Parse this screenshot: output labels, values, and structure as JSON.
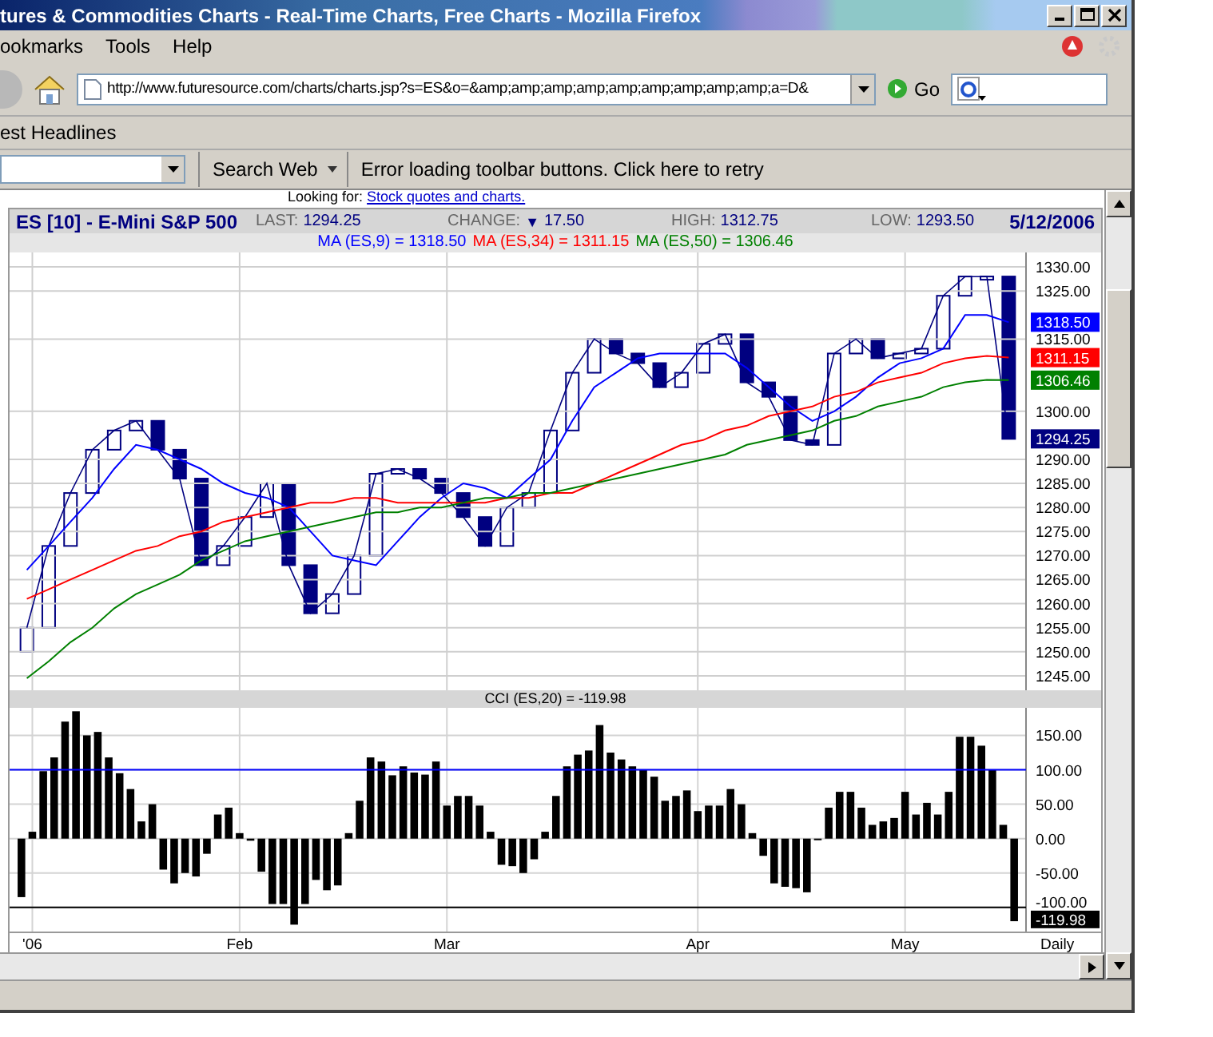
{
  "window": {
    "title": "tures & Commodities Charts - Real-Time Charts, Free Charts - Mozilla Firefox"
  },
  "menu": [
    "ookmarks",
    "Tools",
    "Help"
  ],
  "navigation": {
    "url": "http://www.futuresource.com/charts/charts.jsp?s=ES&o=&amp;amp;amp;amp;amp;amp;amp;amp;amp;a=D&",
    "go": "Go"
  },
  "bookmarks": [
    "est Headlines"
  ],
  "toolbar": {
    "search_button": "Search Web",
    "error_link": "Error loading toolbar buttons. Click here to retry"
  },
  "page": {
    "looking_for": "Looking for:",
    "looking_link": "Stock quotes and charts."
  },
  "chart_header": {
    "date": "5/12/2006",
    "fields": [
      {
        "label": "LAST:",
        "value": "1294.25"
      },
      {
        "label": "CHANGE:",
        "arrow": "▼",
        "value": "17.50"
      },
      {
        "label": "HIGH:",
        "value": "1312.75"
      },
      {
        "label": "LOW:",
        "value": "1293.50"
      }
    ]
  },
  "ma_legend": [
    {
      "value": "= 1318.50"
    },
    {
      "value": "= 1311.15"
    },
    {
      "value": "= 1306.46"
    }
  ],
  "price_panel": {
    "last_values": [
      {
        "text": "1318.50",
        "color": "#0000ff"
      },
      {
        "text": "1311.15",
        "color": "#ff0000"
      },
      {
        "text": "1306.46",
        "color": "#008000"
      },
      {
        "text": "1294.25",
        "color": "#000080"
      }
    ],
    "chart_data": {
      "type": "line",
      "grid": true,
      "categories": [
        null,
        null,
        null,
        null,
        null,
        null,
        null,
        null,
        null,
        null,
        null,
        null,
        null,
        null,
        null,
        null,
        null,
        null,
        null,
        null,
        null,
        null,
        null,
        null,
        null,
        null,
        null,
        null,
        null,
        null,
        null,
        null,
        null,
        null,
        null,
        null,
        null,
        null,
        null,
        null,
        null,
        null,
        null,
        null,
        null,
        null
      ],
      "series": [
        {
          "name": "ES [10] - E-Mini S&P 500",
          "color": "#000080",
          "values": [
            1255,
            1272,
            1283,
            1292,
            1296,
            1298,
            1292,
            1286,
            1268,
            1272,
            1278,
            1285,
            1268,
            1258,
            1262,
            1270,
            1287,
            1288,
            1286,
            1283,
            1278,
            1272,
            1280,
            1283,
            1296,
            1308,
            1315,
            1312,
            1310,
            1305,
            1308,
            1314,
            1316,
            1306,
            1303,
            1294,
            1293,
            1312,
            1315,
            1311,
            1312,
            1313,
            1324,
            1328,
            1328,
            1294.25
          ]
        },
        {
          "name": "MA (ES,9)",
          "color": "#0000ff",
          "values": [
            1267,
            1272,
            1277,
            1282,
            1288,
            1293,
            1292,
            1290,
            1288,
            1285,
            1283,
            1282,
            1280,
            1275,
            1270,
            1269,
            1268,
            1273,
            1278,
            1282,
            1285,
            1284,
            1282,
            1286,
            1290,
            1298,
            1305,
            1308,
            1311,
            1312,
            1312,
            1312,
            1312,
            1309,
            1305,
            1301,
            1298,
            1300,
            1303,
            1307,
            1310,
            1311,
            1313,
            1320,
            1320,
            1318.5
          ]
        },
        {
          "name": "MA (ES,34)",
          "color": "#ff0000",
          "values": [
            1261,
            1263,
            1265,
            1267,
            1269,
            1271,
            1272,
            1274,
            1275,
            1277,
            1278,
            1279,
            1280,
            1281,
            1281,
            1282,
            1282,
            1281,
            1281,
            1281,
            1281,
            1281,
            1282,
            1282,
            1283,
            1283,
            1285,
            1287,
            1289,
            1291,
            1293,
            1294,
            1296,
            1297,
            1299,
            1300,
            1301,
            1303,
            1304,
            1306,
            1307,
            1308,
            1310,
            1311,
            1311.5,
            1311.15
          ]
        },
        {
          "name": "MA (ES,50)",
          "color": "#008000",
          "values": [
            1244.5,
            1248,
            1252,
            1255,
            1259,
            1262,
            1264,
            1266,
            1269,
            1271,
            1273,
            1274,
            1275,
            1276,
            1277,
            1278,
            1279,
            1279,
            1280,
            1280,
            1281,
            1282,
            1282,
            1283,
            1283,
            1284,
            1285,
            1286,
            1287,
            1288,
            1289,
            1290,
            1291,
            1293,
            1294,
            1295,
            1296,
            1298,
            1299,
            1301,
            1302,
            1303,
            1305,
            1306,
            1306.5,
            1306.46
          ]
        }
      ],
      "ylim": [
        1242,
        1333
      ],
      "yticks": [
        {
          "value": 1330,
          "label": "1330.00"
        },
        {
          "value": 1325,
          "label": "1325.00"
        },
        {
          "value": 1315,
          "label": "1315.00"
        },
        {
          "value": 1300,
          "label": "1300.00"
        },
        {
          "value": 1290,
          "label": "1290.00"
        },
        {
          "value": 1285,
          "label": "1285.00"
        },
        {
          "value": 1280,
          "label": "1280.00"
        },
        {
          "value": 1275,
          "label": "1275.00"
        },
        {
          "value": 1270,
          "label": "1270.00"
        },
        {
          "value": 1265,
          "label": "1265.00"
        },
        {
          "value": 1260,
          "label": "1260.00"
        },
        {
          "value": 1255,
          "label": "1255.00"
        },
        {
          "value": 1250,
          "label": "1250.00"
        },
        {
          "value": 1245,
          "label": "1245.00"
        }
      ]
    }
  },
  "cci_panel": {
    "period": "Daily",
    "last_value": {
      "text": "-119.98"
    },
    "chart_data": {
      "type": "bar",
      "title": "CCI (ES,20) = -119.98",
      "grid": true,
      "categories": [
        null,
        "'06",
        null,
        null,
        null,
        null,
        null,
        null,
        null,
        null,
        null,
        null,
        null,
        null,
        null,
        null,
        null,
        null,
        null,
        null,
        "Feb",
        null,
        null,
        null,
        null,
        null,
        null,
        null,
        null,
        null,
        null,
        null,
        null,
        null,
        null,
        null,
        null,
        null,
        null,
        "Mar",
        null,
        null,
        null,
        null,
        null,
        null,
        null,
        null,
        null,
        null,
        null,
        null,
        null,
        null,
        null,
        null,
        null,
        null,
        null,
        null,
        null,
        null,
        "Apr",
        null,
        null,
        null,
        null,
        null,
        null,
        null,
        null,
        null,
        null,
        null,
        null,
        null,
        null,
        null,
        null,
        null,
        null,
        "May",
        null,
        null,
        null,
        null,
        null,
        null,
        null,
        null,
        null,
        null
      ],
      "values": [
        -85,
        10,
        98,
        118,
        170,
        185,
        150,
        155,
        118,
        95,
        72,
        25,
        50,
        -45,
        -65,
        -50,
        -55,
        -22,
        35,
        45,
        8,
        -3,
        -48,
        -95,
        -95,
        -125,
        -95,
        -60,
        -75,
        -68,
        8,
        55,
        118,
        112,
        92,
        105,
        96,
        93,
        112,
        48,
        62,
        62,
        48,
        10,
        -38,
        -40,
        -50,
        -30,
        10,
        62,
        105,
        122,
        128,
        165,
        125,
        115,
        105,
        100,
        90,
        55,
        62,
        70,
        40,
        48,
        48,
        72,
        50,
        8,
        -25,
        -65,
        -70,
        -72,
        -78,
        0,
        45,
        68,
        68,
        45,
        20,
        25,
        30,
        68,
        35,
        52,
        35,
        68,
        148,
        148,
        135,
        100,
        20,
        -119.98
      ],
      "ylim": [
        -135,
        190
      ],
      "yticks": [
        {
          "value": 150,
          "label": "150.00"
        },
        {
          "value": 100,
          "label": "100.00"
        },
        {
          "value": 50,
          "label": "50.00"
        },
        {
          "value": 0,
          "label": "0.00"
        },
        {
          "value": -50,
          "label": "-50.00"
        },
        {
          "value": -100,
          "label": "-100.00"
        }
      ],
      "ref_lines": [
        {
          "axis": "y",
          "value": 100,
          "color": "#0000ff"
        },
        {
          "axis": "y",
          "value": -100,
          "color": "#000000"
        }
      ]
    }
  }
}
